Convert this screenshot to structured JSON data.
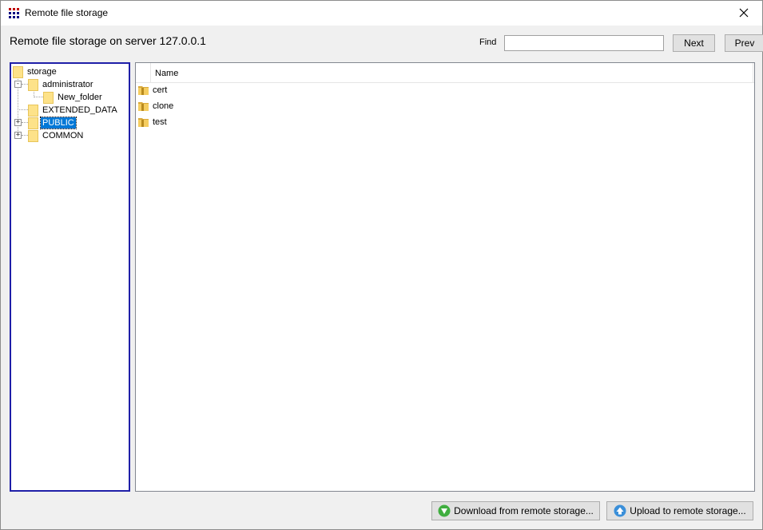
{
  "window": {
    "title": "Remote file storage",
    "icon": "app-grid-icon",
    "close_icon": "close-icon"
  },
  "header": {
    "heading": "Remote file storage on server 127.0.0.1",
    "find_label": "Find",
    "find_value": "",
    "next_label": "Next",
    "prev_label": "Prev"
  },
  "tree": {
    "items": [
      {
        "label": "storage",
        "level": 0,
        "expander": "",
        "selected": false
      },
      {
        "label": "administrator",
        "level": 1,
        "expander": "-",
        "selected": false
      },
      {
        "label": "New_folder",
        "level": 2,
        "expander": "",
        "selected": false
      },
      {
        "label": "EXTENDED_DATA",
        "level": 1,
        "expander": "",
        "selected": false
      },
      {
        "label": "PUBLIC",
        "level": 1,
        "expander": "+",
        "selected": true
      },
      {
        "label": "COMMON",
        "level": 1,
        "expander": "+",
        "selected": false
      }
    ]
  },
  "list": {
    "column_name": "Name",
    "rows": [
      {
        "name": "cert",
        "icon": "folder-icon"
      },
      {
        "name": "clone",
        "icon": "folder-icon"
      },
      {
        "name": "test",
        "icon": "folder-icon"
      }
    ]
  },
  "footer": {
    "download_label": "Download from remote storage...",
    "upload_label": "Upload to remote storage...",
    "download_icon": "download-arrow-icon",
    "upload_icon": "upload-arrow-icon"
  },
  "colors": {
    "selection": "#0078d7",
    "tree_border": "#1f1fa8",
    "folder": "#fde289",
    "download_green": "#3fae3f",
    "upload_blue": "#3a8fd9"
  }
}
